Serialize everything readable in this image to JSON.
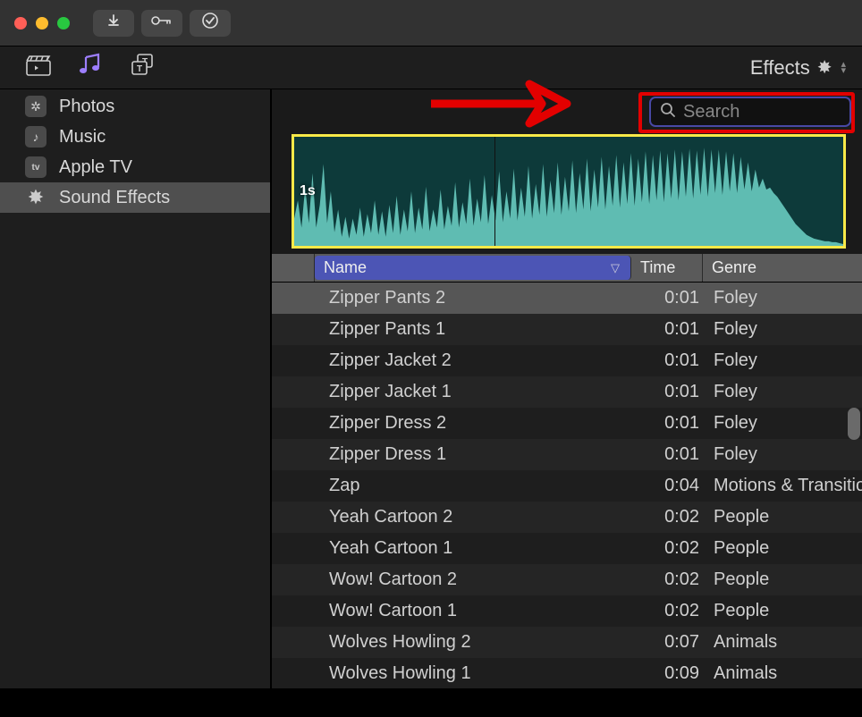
{
  "titlebar": {},
  "toolbar": {
    "effects_label": "Effects"
  },
  "sidebar": {
    "items": [
      {
        "label": "Photos"
      },
      {
        "label": "Music"
      },
      {
        "label": "Apple TV"
      },
      {
        "label": "Sound Effects"
      }
    ]
  },
  "search": {
    "placeholder": "Search",
    "value": ""
  },
  "waveform": {
    "label": "1s"
  },
  "table": {
    "columns": {
      "name": "Name",
      "time": "Time",
      "genre": "Genre"
    },
    "rows": [
      {
        "name": "Zipper Pants 2",
        "time": "0:01",
        "genre": "Foley",
        "selected": true
      },
      {
        "name": "Zipper Pants 1",
        "time": "0:01",
        "genre": "Foley"
      },
      {
        "name": "Zipper Jacket 2",
        "time": "0:01",
        "genre": "Foley"
      },
      {
        "name": "Zipper Jacket 1",
        "time": "0:01",
        "genre": "Foley"
      },
      {
        "name": "Zipper Dress 2",
        "time": "0:01",
        "genre": "Foley"
      },
      {
        "name": "Zipper Dress 1",
        "time": "0:01",
        "genre": "Foley"
      },
      {
        "name": "Zap",
        "time": "0:04",
        "genre": "Motions & Transitio"
      },
      {
        "name": "Yeah Cartoon 2",
        "time": "0:02",
        "genre": "People"
      },
      {
        "name": "Yeah Cartoon 1",
        "time": "0:02",
        "genre": "People"
      },
      {
        "name": "Wow! Cartoon 2",
        "time": "0:02",
        "genre": "People"
      },
      {
        "name": "Wow! Cartoon 1",
        "time": "0:02",
        "genre": "People"
      },
      {
        "name": "Wolves Howling 2",
        "time": "0:07",
        "genre": "Animals"
      },
      {
        "name": "Wolves Howling 1",
        "time": "0:09",
        "genre": "Animals"
      }
    ]
  }
}
